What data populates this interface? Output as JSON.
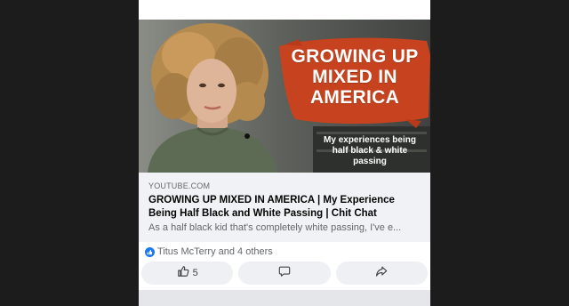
{
  "thumbnail": {
    "headline": "GROWING UP MIXED IN AMERICA",
    "subtitle": "My experiences being half black & white passing",
    "accent_color": "#c7431f"
  },
  "link": {
    "domain": "YOUTUBE.COM",
    "title": "GROWING UP MIXED IN AMERICA | My Experience Being Half Black and White Passing | Chit Chat",
    "description": "As a half black kid that's completely white passing, I've e..."
  },
  "reactions": {
    "icon": "like-icon",
    "text": "Titus McTerry and 4 others"
  },
  "actions": {
    "like_icon": "thumbs-up-icon",
    "like_count": "5",
    "comment_icon": "comment-icon",
    "share_icon": "share-icon"
  }
}
